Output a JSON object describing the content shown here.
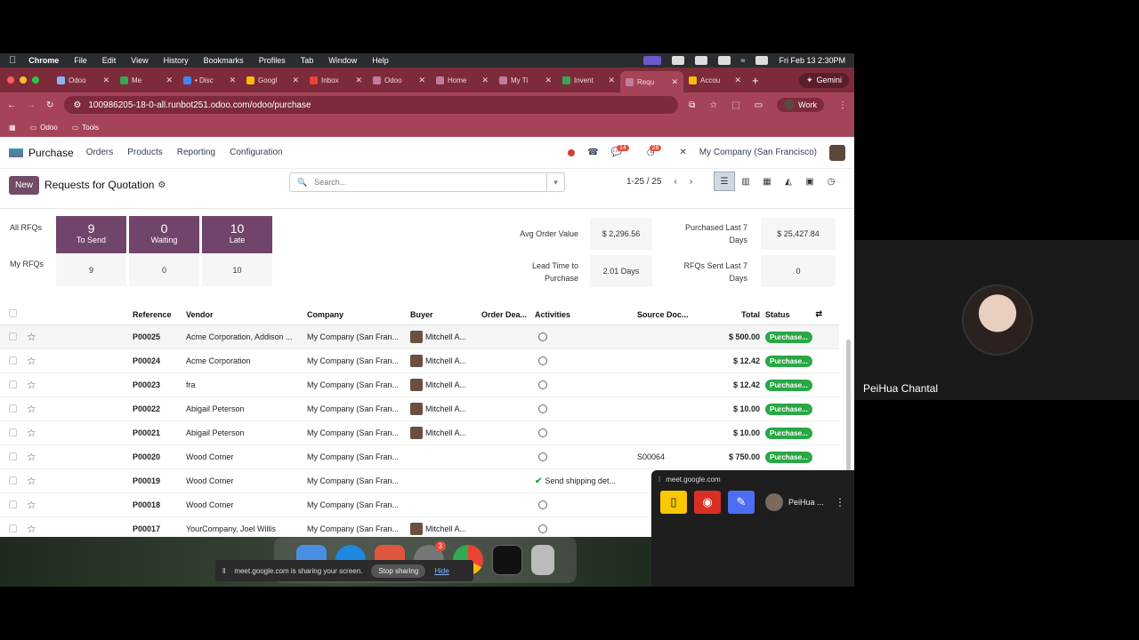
{
  "mac_menu": {
    "app": "Chrome",
    "items": [
      "File",
      "Edit",
      "View",
      "History",
      "Bookmarks",
      "Profiles",
      "Tab",
      "Window",
      "Help"
    ],
    "clock": "Fri Feb 13  2:30PM"
  },
  "tabs": [
    {
      "label": "Odoo",
      "active": false
    },
    {
      "label": "Me",
      "active": false
    },
    {
      "label": "• Disc",
      "active": false
    },
    {
      "label": "Googl",
      "active": false
    },
    {
      "label": "Inbox",
      "active": false
    },
    {
      "label": "Odoo",
      "active": false
    },
    {
      "label": "Home",
      "active": false
    },
    {
      "label": "My Ti",
      "active": false
    },
    {
      "label": "Invent",
      "active": false
    },
    {
      "label": "Requ",
      "active": true
    },
    {
      "label": "Accou",
      "active": false
    }
  ],
  "gemini_label": "Gemini",
  "address": {
    "url": "100986205-18-0-all.runbot251.odoo.com/odoo/purchase",
    "profile": "Work"
  },
  "bookmarks": [
    "Odoo",
    "Tools"
  ],
  "odoo": {
    "app_name": "Purchase",
    "menu": [
      "Orders",
      "Products",
      "Reporting",
      "Configuration"
    ],
    "chat_count": "14",
    "activity_count": "28",
    "company": "My Company (San Francisco)",
    "new_label": "New",
    "page_title": "Requests for Quotation",
    "search_placeholder": "Search...",
    "pager": "1-25 / 25"
  },
  "dashboard": {
    "all_label": "All RFQs",
    "my_label": "My RFQs",
    "tiles": [
      {
        "value": "9",
        "label": "To Send",
        "mine": "9"
      },
      {
        "value": "0",
        "label": "Waiting",
        "mine": "0"
      },
      {
        "value": "10",
        "label": "Late",
        "mine": "10"
      }
    ],
    "kpis": {
      "avg_order_label": "Avg Order Value",
      "avg_order_value": "$ 2,296.56",
      "purchased_label": "Purchased Last 7 Days",
      "purchased_value": "$ 25,427.84",
      "lead_time_label": "Lead Time to Purchase",
      "lead_time_value": "2.01 Days",
      "rfqs_sent_label": "RFQs Sent Last 7 Days",
      "rfqs_sent_value": "0"
    }
  },
  "table": {
    "columns": [
      "Reference",
      "Vendor",
      "Company",
      "Buyer",
      "Order Dea...",
      "Activities",
      "Source Doc...",
      "Total",
      "Status"
    ],
    "rows": [
      {
        "ref": "P00025",
        "vendor": "Acme Corporation, Addison ...",
        "company": "My Company (San Fran...",
        "buyer": "Mitchell A...",
        "activity": "",
        "source": "",
        "total": "$ 500.00",
        "status": "Purchase..."
      },
      {
        "ref": "P00024",
        "vendor": "Acme Corporation",
        "company": "My Company (San Fran...",
        "buyer": "Mitchell A...",
        "activity": "",
        "source": "",
        "total": "$ 12.42",
        "status": "Purchase..."
      },
      {
        "ref": "P00023",
        "vendor": "fra",
        "company": "My Company (San Fran...",
        "buyer": "Mitchell A...",
        "activity": "",
        "source": "",
        "total": "$ 12.42",
        "status": "Purchase..."
      },
      {
        "ref": "P00022",
        "vendor": "Abigail Peterson",
        "company": "My Company (San Fran...",
        "buyer": "Mitchell A...",
        "activity": "",
        "source": "",
        "total": "$ 10.00",
        "status": "Purchase..."
      },
      {
        "ref": "P00021",
        "vendor": "Abigail Peterson",
        "company": "My Company (San Fran...",
        "buyer": "Mitchell A...",
        "activity": "",
        "source": "",
        "total": "$ 10.00",
        "status": "Purchase..."
      },
      {
        "ref": "P00020",
        "vendor": "Wood Corner",
        "company": "My Company (San Fran...",
        "buyer": "",
        "activity": "",
        "source": "S00064",
        "total": "$ 750.00",
        "status": "Purchase..."
      },
      {
        "ref": "P00019",
        "vendor": "Wood Corner",
        "company": "My Company (San Fran...",
        "buyer": "",
        "activity": "Send shipping det...",
        "source": "",
        "total": "",
        "status": ""
      },
      {
        "ref": "P00018",
        "vendor": "Wood Corner",
        "company": "My Company (San Fran...",
        "buyer": "",
        "activity": "",
        "source": "",
        "total": "",
        "status": ""
      },
      {
        "ref": "P00017",
        "vendor": "YourCompany, Joel Willis",
        "company": "My Company (San Fran...",
        "buyer": "Mitchell A...",
        "activity": "",
        "source": "",
        "total": "",
        "status": ""
      }
    ]
  },
  "screen_share": {
    "message": "meet.google.com is sharing your screen.",
    "stop_label": "Stop sharing",
    "hide_label": "Hide"
  },
  "dock_badge": "3",
  "meet_panel": {
    "url": "meet.google.com",
    "person": "PeiHua ..."
  },
  "participant": {
    "name": "PeiHua Chantal"
  }
}
